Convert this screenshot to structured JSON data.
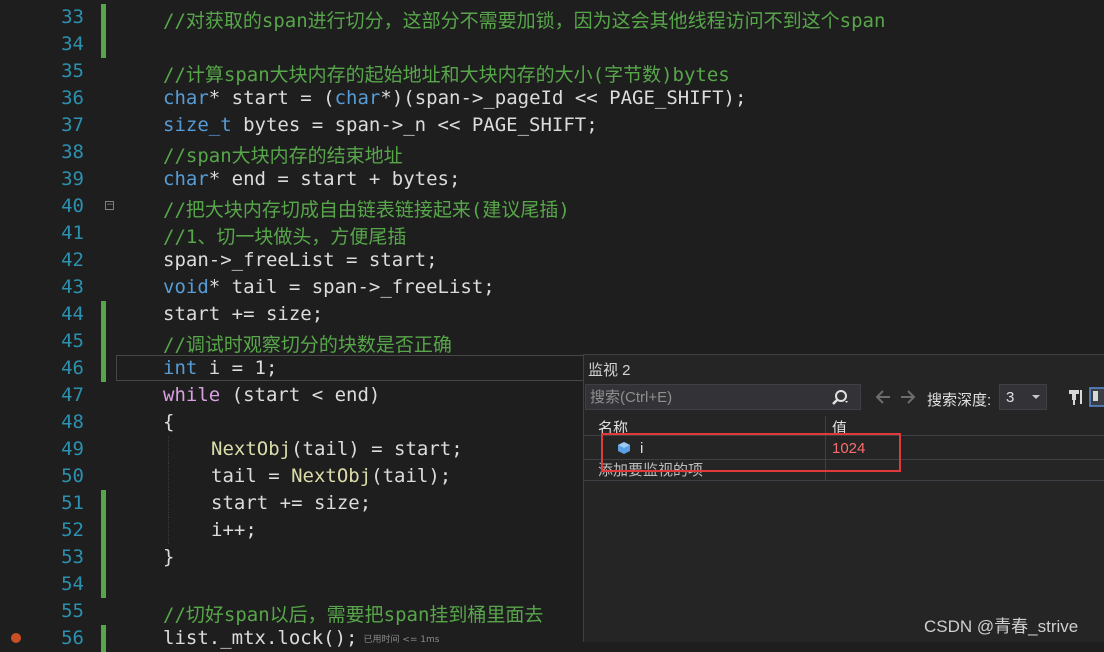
{
  "editor": {
    "lines": [
      {
        "num": "33",
        "text": "//对获取的span进行切分，这部分不需要加锁，因为这会其他线程访问不到这个span"
      },
      {
        "num": "34",
        "text": ""
      },
      {
        "num": "35",
        "text": "//计算span大块内存的起始地址和大块内存的大小(字节数)bytes"
      },
      {
        "num": "36",
        "parts": [
          "char",
          "* start = (",
          "char",
          "*)(span->_pageId << PAGE_SHIFT);"
        ]
      },
      {
        "num": "37",
        "parts": [
          "size_t",
          " bytes = span->_n << PAGE_SHIFT;"
        ]
      },
      {
        "num": "38",
        "text": "//span大块内存的结束地址"
      },
      {
        "num": "39",
        "parts": [
          "char",
          "* end = start + bytes;"
        ]
      },
      {
        "num": "40",
        "text": "//把大块内存切成自由链表链接起来(建议尾插)"
      },
      {
        "num": "41",
        "text": "//1、切一块做头，方便尾插"
      },
      {
        "num": "42",
        "text": "span->_freeList = start;"
      },
      {
        "num": "43",
        "parts": [
          "void",
          "* tail = span->_freeList;"
        ]
      },
      {
        "num": "44",
        "text": "start += size;"
      },
      {
        "num": "45",
        "text": "//调试时观察切分的块数是否正确"
      },
      {
        "num": "46",
        "parts": [
          "int",
          " i = 1;"
        ]
      },
      {
        "num": "47",
        "parts": [
          "while",
          " (start < end)"
        ]
      },
      {
        "num": "48",
        "text": "{"
      },
      {
        "num": "49",
        "parts": [
          "NextObj",
          "(tail) = start;"
        ]
      },
      {
        "num": "50",
        "parts": [
          "tail = ",
          "NextObj",
          "(tail);"
        ]
      },
      {
        "num": "51",
        "text": "start += size;"
      },
      {
        "num": "52",
        "text": "i++;"
      },
      {
        "num": "53",
        "text": "}"
      },
      {
        "num": "54",
        "text": ""
      },
      {
        "num": "55",
        "text": "//切好span以后，需要把span挂到桶里面去"
      },
      {
        "num": "56",
        "parts": [
          "list._mtx.lock();"
        ],
        "hint": "已用时间 <= 1ms"
      }
    ]
  },
  "watch": {
    "title": "监视 2",
    "search_placeholder": "搜索(Ctrl+E)",
    "depth_label": "搜索深度:",
    "depth_value": "3",
    "col_name": "名称",
    "col_value": "值",
    "rows": [
      {
        "name": "i",
        "value": "1024"
      }
    ],
    "add_item": "添加要监视的项"
  },
  "watermark": "CSDN @青春_strive",
  "colors": {
    "comment": "#57a64a",
    "keyword": "#569cd6",
    "control": "#d8a0df",
    "function": "#dcdcaa",
    "line_number": "#2b91af",
    "value_changed": "#f86c6c",
    "highlight": "#e03a3a"
  }
}
